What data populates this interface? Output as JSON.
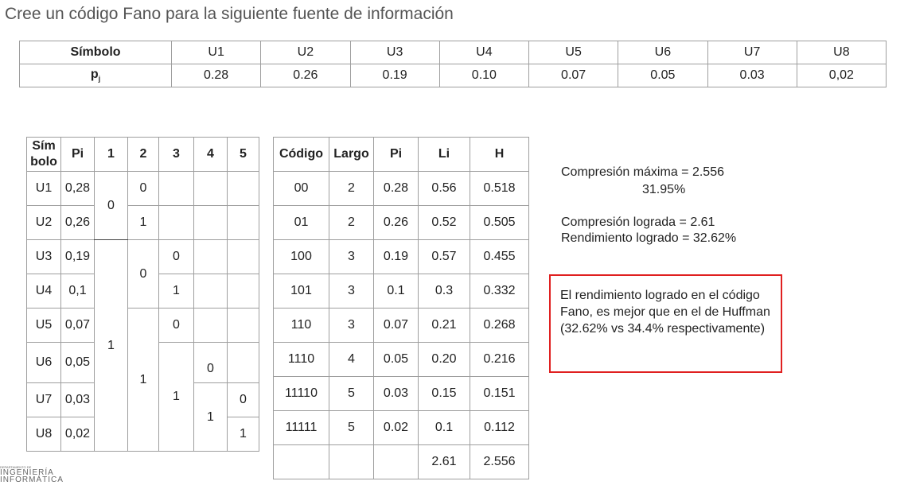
{
  "title": "Cree un código Fano para la siguiente fuente de información",
  "source_table": {
    "header_label": "Símbolo",
    "prob_label": "p",
    "prob_sub": "j",
    "symbols": [
      "U1",
      "U2",
      "U3",
      "U4",
      "U5",
      "U6",
      "U7",
      "U8"
    ],
    "probs": [
      "0.28",
      "0.26",
      "0.19",
      "0.10",
      "0.07",
      "0.05",
      "0.03",
      "0,02"
    ]
  },
  "fano_table": {
    "headers": {
      "sym_top": "Sím",
      "sym_bottom": "bolo",
      "pi": "Pi",
      "c1": "1",
      "c2": "2",
      "c3": "3",
      "c4": "4",
      "c5": "5"
    },
    "rows": [
      {
        "sym": "U1",
        "pi": "0,28"
      },
      {
        "sym": "U2",
        "pi": "0,26"
      },
      {
        "sym": "U3",
        "pi": "0,19"
      },
      {
        "sym": "U4",
        "pi": "0,1"
      },
      {
        "sym": "U5",
        "pi": "0,07"
      },
      {
        "sym": "U6",
        "pi": "0,05"
      },
      {
        "sym": "U7",
        "pi": "0,03"
      },
      {
        "sym": "U8",
        "pi": "0,02"
      }
    ],
    "bits": {
      "c1_a": "0",
      "c1_b": "1",
      "c2_u1": "0",
      "c2_u2": "1",
      "c2_u3u4": "0",
      "c2_u5u8": "1",
      "c3_u3": "0",
      "c3_u4": "1",
      "c3_u5": "0",
      "c3_u6u8": "1",
      "c4_u6": "0",
      "c4_u7u8": "1",
      "c5_u7": "0",
      "c5_u8": "1"
    }
  },
  "code_table": {
    "headers": [
      "Código",
      "Largo",
      "Pi",
      "Li",
      "H"
    ],
    "rows": [
      [
        "00",
        "2",
        "0.28",
        "0.56",
        "0.518"
      ],
      [
        "01",
        "2",
        "0.26",
        "0.52",
        "0.505"
      ],
      [
        "100",
        "3",
        "0.19",
        "0.57",
        "0.455"
      ],
      [
        "101",
        "3",
        "0.1",
        "0.3",
        "0.332"
      ],
      [
        "110",
        "3",
        "0.07",
        "0.21",
        "0.268"
      ],
      [
        "1110",
        "4",
        "0.05",
        "0.20",
        "0.216"
      ],
      [
        "11110",
        "5",
        "0.03",
        "0.15",
        "0.151"
      ],
      [
        "11111",
        "5",
        "0.02",
        "0.1",
        "0.112"
      ]
    ],
    "totals": [
      "",
      "",
      "",
      "2.61",
      "2.556"
    ]
  },
  "stats": {
    "max_compression": "Compresión máxima = 2.556",
    "max_percent": "31.95%",
    "achieved_compression": "Compresión lograda = 2.61",
    "achieved_performance": "Rendimiento logrado = 32.62%"
  },
  "note": "El rendimiento logrado en el código Fano, es mejor que en el de Huffman (32.62% vs 34.4% respectivamente)",
  "logo": {
    "line1": "DEPARTAMENTO DE",
    "line2": "INGENIERÍA",
    "line3": "INFORMÁTICA"
  },
  "colors": {
    "note_border": "#e02020",
    "grid": "#9e9e9e"
  }
}
